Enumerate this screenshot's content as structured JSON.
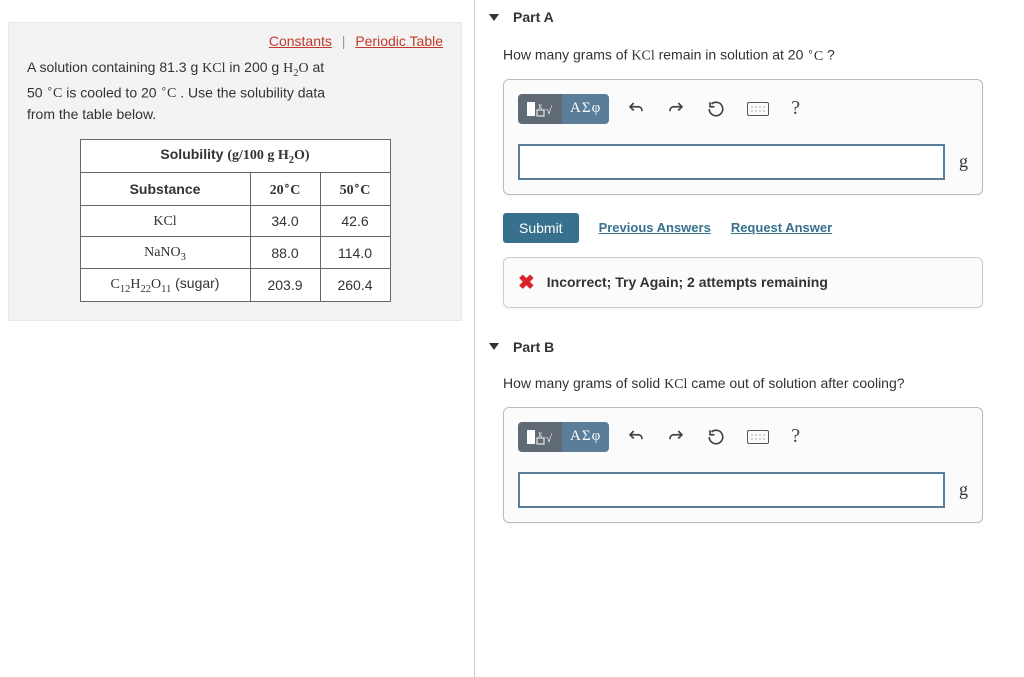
{
  "links": {
    "constants": "Constants",
    "periodic": "Periodic Table",
    "sep": "|"
  },
  "problem": {
    "line1_a": "A solution containing 81.3 g ",
    "kcl": "KCl",
    "line1_b": " in 200 g ",
    "h2o": "H2O",
    "line1_c": " at",
    "line2_a": "50 ",
    "degC": "°C",
    "line2_b": " is cooled to 20 ",
    "line2_c": " . Use the solubility data",
    "line3": "from the table below."
  },
  "table": {
    "header": "Solubility (g/100 g H2O)",
    "cols": {
      "substance": "Substance",
      "c20": "20°C",
      "c50": "50°C"
    },
    "rows": [
      {
        "name": "KCl",
        "c20": "34.0",
        "c50": "42.6"
      },
      {
        "name": "NaNO3",
        "c20": "88.0",
        "c50": "114.0"
      },
      {
        "name": "C12H22O11 (sugar)",
        "c20": "203.9",
        "c50": "260.4"
      }
    ]
  },
  "partA": {
    "title": "Part A",
    "question_a": "How many grams of ",
    "question_b": " remain in solution at 20 ",
    "question_c": " ?",
    "unit": "g",
    "submit": "Submit",
    "previous": "Previous Answers",
    "request": "Request Answer",
    "feedback": "Incorrect; Try Again; 2 attempts remaining"
  },
  "partB": {
    "title": "Part B",
    "question_a": "How many grams of solid ",
    "question_b": " came out of solution after cooling?",
    "unit": "g"
  },
  "toolbar": {
    "greek": "ΑΣφ",
    "help": "?"
  }
}
